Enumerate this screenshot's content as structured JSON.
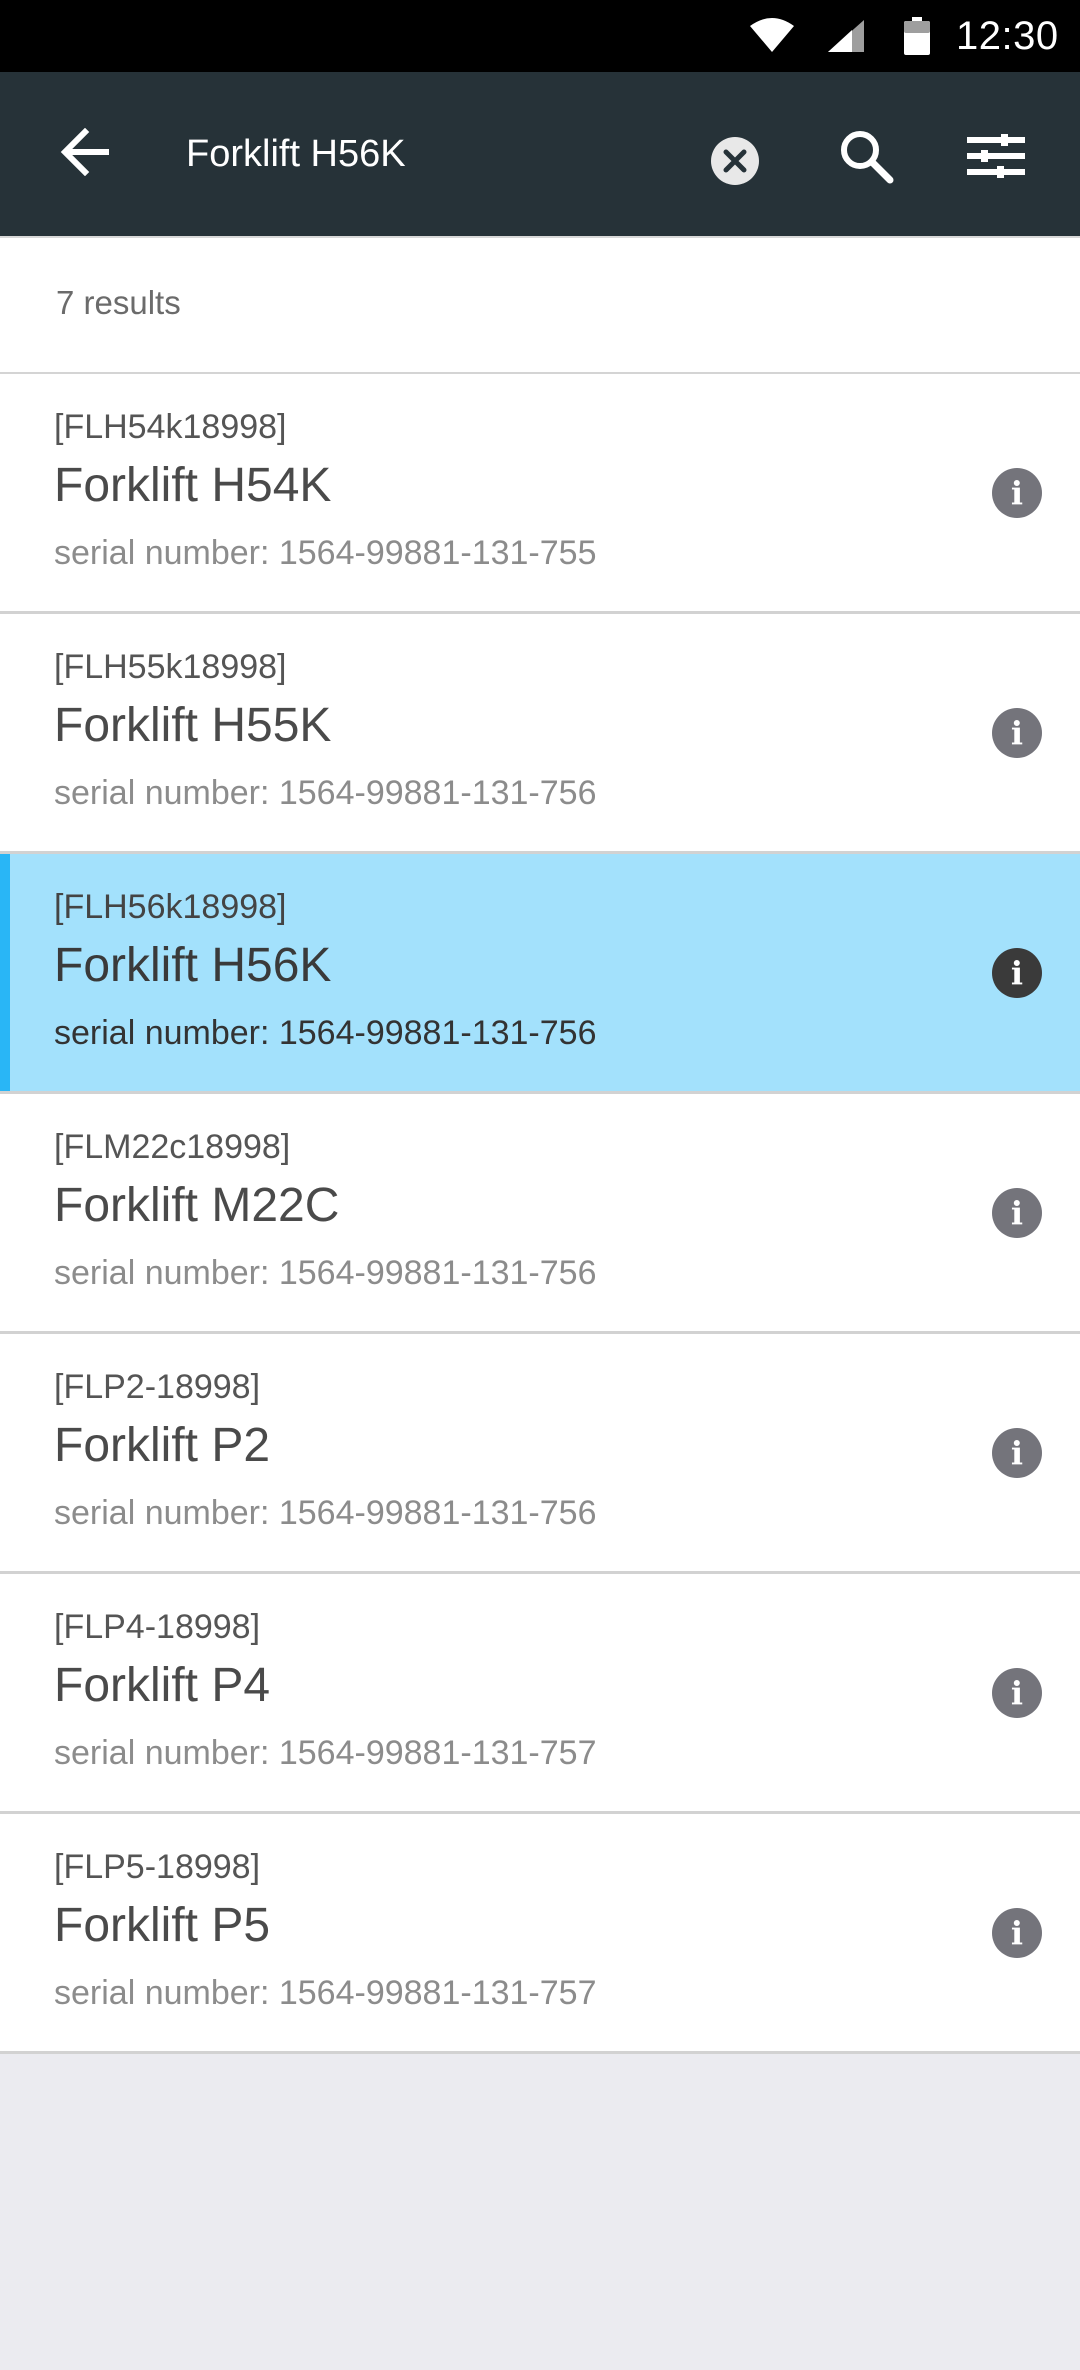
{
  "status_bar": {
    "time": "12:30",
    "icons": [
      "wifi-icon",
      "cell-signal-icon",
      "battery-icon"
    ]
  },
  "app_bar": {
    "search_value": "Forklift H56K",
    "icons": [
      "back-arrow-icon",
      "clear-icon",
      "search-icon",
      "filter-icon"
    ]
  },
  "results": {
    "count_label": "7 results",
    "items": [
      {
        "code": "[FLH54k18998]",
        "name": "Forklift H54K",
        "serial": "serial number: 1564-99881-131-755",
        "selected": false
      },
      {
        "code": "[FLH55k18998]",
        "name": "Forklift H55K",
        "serial": "serial number: 1564-99881-131-756",
        "selected": false
      },
      {
        "code": "[FLH56k18998]",
        "name": "Forklift H56K",
        "serial": "serial number: 1564-99881-131-756",
        "selected": true
      },
      {
        "code": "[FLM22c18998]",
        "name": "Forklift M22C",
        "serial": "serial number: 1564-99881-131-756",
        "selected": false
      },
      {
        "code": "[FLP2-18998]",
        "name": "Forklift P2",
        "serial": "serial number: 1564-99881-131-756",
        "selected": false
      },
      {
        "code": "[FLP4-18998]",
        "name": "Forklift P4",
        "serial": "serial number: 1564-99881-131-757",
        "selected": false
      },
      {
        "code": "[FLP5-18998]",
        "name": "Forklift P5",
        "serial": "serial number: 1564-99881-131-757",
        "selected": false
      }
    ],
    "info_glyph": "i"
  },
  "colors": {
    "app_bar": "#263238",
    "selected_row": "#a3e1fc",
    "selected_accent": "#29b6f6",
    "background": "#ebebf0"
  }
}
